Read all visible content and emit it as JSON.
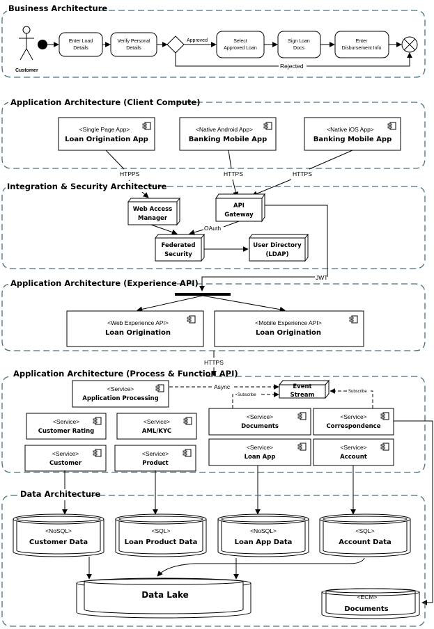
{
  "diagram": {
    "business": {
      "title": "Business Architecture",
      "actor": "Customer",
      "steps": [
        "Enter Load Details",
        "Verify Personal Details",
        "Select Approved Loan",
        "Sign Loan Docs",
        "Enter Disbursement Info"
      ],
      "step_lines": [
        [
          "Enter Load",
          "Details"
        ],
        [
          "Verify Personal",
          "Details"
        ],
        [
          "Select",
          "Approved Loan"
        ],
        [
          "Sign Loan",
          "Docs"
        ],
        [
          "Enter",
          "Disbursement Info"
        ]
      ],
      "approved_label": "Approved",
      "rejected_label": "Rejected"
    },
    "client": {
      "title": "Application Architecture (Client Compute)",
      "apps": [
        {
          "stereotype": "<Single Page App>",
          "name": "Loan Origination App"
        },
        {
          "stereotype": "<Native Android App>",
          "name": "Banking Mobile App"
        },
        {
          "stereotype": "<Native iOS App>",
          "name": "Banking Mobile App"
        }
      ],
      "conn_labels": [
        "HTPPS",
        "HTTPS",
        "HTTPS"
      ]
    },
    "integration": {
      "title": "Integration & Security Architecture",
      "nodes": [
        {
          "line1": "Web Access",
          "line2": "Manager"
        },
        {
          "line1": "API",
          "line2": "Gateway"
        },
        {
          "line1": "Federated",
          "line2": "Security"
        },
        {
          "line1": "User Directory",
          "line2": "(LDAP)"
        }
      ],
      "oauth_label": "OAuth",
      "jwt_label": "JWT"
    },
    "experience": {
      "title": "Application Architecture (Experience API)",
      "apis": [
        {
          "stereotype": "<Web Experience API>",
          "name": "Loan Origination"
        },
        {
          "stereotype": "<Mobile Experience API>",
          "name": "Loan Origination"
        }
      ],
      "https_label": "HTTPS"
    },
    "process": {
      "title": "Application Architecture (Process & Function API)",
      "services": [
        {
          "stereotype": "<Service>",
          "name": "Application Processing"
        },
        {
          "stereotype": "<Service>",
          "name": "Customer Rating"
        },
        {
          "stereotype": "<Service>",
          "name": "AML/KYC"
        },
        {
          "stereotype": "<Service>",
          "name": "Customer"
        },
        {
          "stereotype": "<Service>",
          "name": "Product"
        },
        {
          "stereotype": "<Service>",
          "name": "Documents"
        },
        {
          "stereotype": "<Service>",
          "name": "Correspondence"
        },
        {
          "stereotype": "<Service>",
          "name": "Loan App"
        },
        {
          "stereotype": "<Service>",
          "name": "Account"
        }
      ],
      "event_stream": {
        "line1": "Event",
        "line2": "Stream"
      },
      "async_label": "Async",
      "subscribe_label": "Subscribe"
    },
    "data": {
      "title": "Data Architecture",
      "stores": [
        {
          "stereotype": "<NoSQL>",
          "name": "Customer Data"
        },
        {
          "stereotype": "<SQL>",
          "name": "Loan Product Data"
        },
        {
          "stereotype": "<NoSQL>",
          "name": "Loan App Data"
        },
        {
          "stereotype": "<SQL>",
          "name": "Account Data"
        }
      ],
      "lake": "Data Lake",
      "ecm": {
        "stereotype": "<ECM>",
        "name": "Documents"
      }
    }
  }
}
